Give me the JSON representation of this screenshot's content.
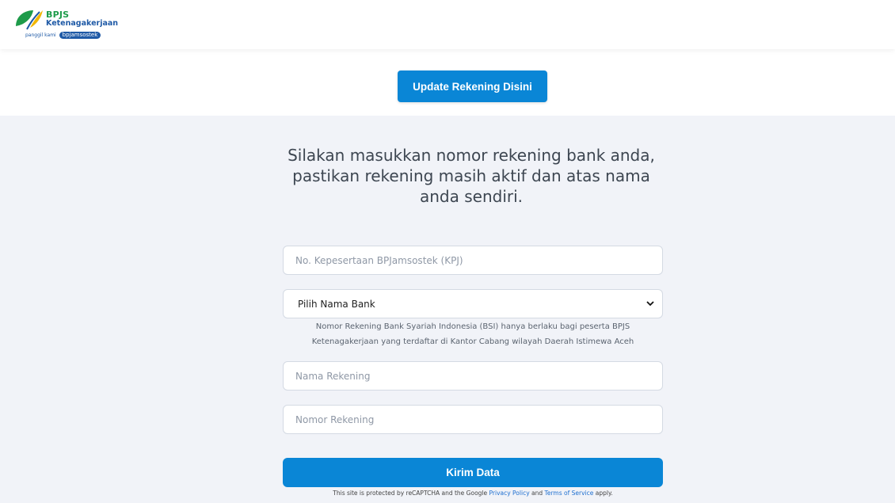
{
  "header": {
    "brand": "BPJS",
    "brand_sub": "Ketenagakerjaan",
    "tagline_prefix": "panggil kami",
    "tagline_badge": "bpjamsostek"
  },
  "hero": {
    "update_button": "Update Rekening Disini"
  },
  "form": {
    "heading_lines": [
      "Silakan masukkan nomor rekening bank anda,",
      "pastikan rekening masih aktif dan atas nama",
      "anda sendiri."
    ],
    "kpj_placeholder": "No. Kepesertaan BPJamsostek (KPJ)",
    "bank_select": "Pilih Nama Bank",
    "bank_note_lines": [
      "Nomor Rekening Bank Syariah Indonesia (BSI) hanya berlaku bagi peserta BPJS",
      "Ketenagakerjaan yang terdaftar di Kantor Cabang wilayah Daerah Istimewa Aceh"
    ],
    "account_name_placeholder": "Nama Rekening",
    "account_number_placeholder": "Nomor Rekening",
    "submit_button": "Kirim Data"
  },
  "recaptcha": {
    "prefix": "This site is protected by reCAPTCHA and the Google",
    "privacy_link": "Privacy Policy",
    "and": "and",
    "terms_link": "Terms of Service",
    "suffix": "apply."
  },
  "colors": {
    "primary": "#0a86d6",
    "brand_green": "#1e9b4a",
    "brand_blue": "#1f5aa6",
    "background": "#f1f3f8"
  },
  "icons": {
    "logo": "bpjs-leaf-logo",
    "select": "chevron-down-icon"
  }
}
